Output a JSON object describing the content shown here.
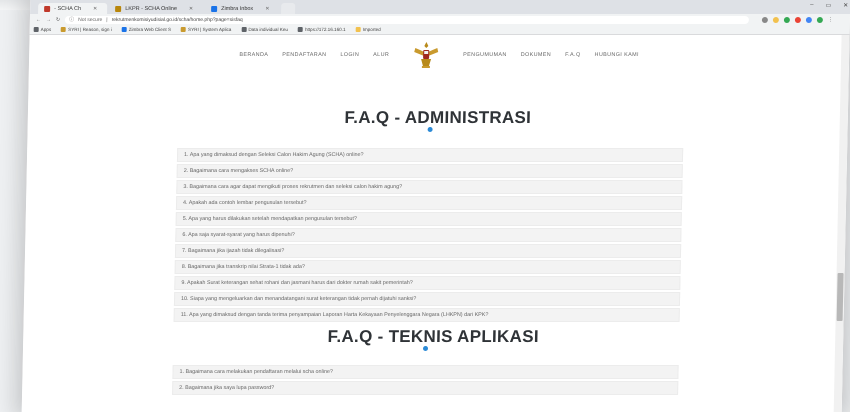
{
  "browser": {
    "tabs": [
      {
        "label": "- SCHA Ch",
        "active": true,
        "color": "#c0392b"
      },
      {
        "label": "LKPR - SCHA Online",
        "active": false,
        "color": "#b8860b"
      },
      {
        "label": "Zimbra Inbox",
        "active": false,
        "color": "#1a73e8"
      }
    ],
    "window_controls": [
      "–",
      "▭",
      "✕"
    ],
    "not_secure": "Not secure",
    "url": "rekrutmenkomisiyudisial.go.id/scha/home.php?page=sisfaq",
    "bookmarks": [
      {
        "label": "Apps",
        "color": "#5f6368"
      },
      {
        "label": "SYRI | Reason, sign i",
        "color": "#c99a2e"
      },
      {
        "label": "Zimbra Web Client S",
        "color": "#1a73e8"
      },
      {
        "label": "SYRI | System Aplica",
        "color": "#c99a2e"
      },
      {
        "label": "Data individual Keu",
        "color": "#5f6368"
      },
      {
        "label": "https://172.16.160.1",
        "color": "#5f6368"
      },
      {
        "label": "Imported",
        "color": "#f2c14e"
      }
    ],
    "extension_colors": [
      "#888888",
      "#f2c14e",
      "#34a853",
      "#ea4335",
      "#4285f4",
      "#34a853"
    ]
  },
  "nav": {
    "left": [
      "BERANDA",
      "PENDAFTARAN",
      "LOGIN",
      "ALUR"
    ],
    "right": [
      "PENGUMUMAN",
      "DOKUMEN",
      "F.A.Q",
      "HUBUNGI KAMI"
    ],
    "emblem": "garuda-emblem"
  },
  "sections": [
    {
      "title": "F.A.Q - ADMINISTRASI",
      "items": [
        "1. Apa yang dimaksud dengan Seleksi Calon Hakim Agung (SCHA) online?",
        "2. Bagaimana cara mengakses SCHA online?",
        "3. Bagaimana cara agar dapat mengikuti proses rekrutmen dan seleksi calon hakim agung?",
        "4. Apakah ada contoh lembar pengusulan tersebut?",
        "5. Apa yang harus dilakukan setelah mendapatkan pengusulan tersebut?",
        "6. Apa saja syarat-syarat yang harus dipenuhi?",
        "7. Bagaimana jika ijazah tidak dilegalisasi?",
        "8. Bagaimana jika transkrip nilai Strata-1 tidak ada?",
        "9. Apakah Surat keterangan sehat rohani dan jasmani harus dari dokter rumah sakit pemerintah?",
        "10. Siapa yang mengeluarkan dan menandatangani surat keterangan tidak pernah dijatuhi sanksi?",
        "11. Apa yang dimaksud dengan tanda terima penyampaian Laporan Harta Kekayaan Penyelenggara Negara (LHKPN) dari KPK?"
      ]
    },
    {
      "title": "F.A.Q - TEKNIS APLIKASI",
      "items": [
        "1. Bagaimana cara melakukan pendaftaran melalui scha online?",
        "2. Bagaimana jika saya lupa password?"
      ]
    }
  ],
  "accent_color": "#2b8ad6"
}
